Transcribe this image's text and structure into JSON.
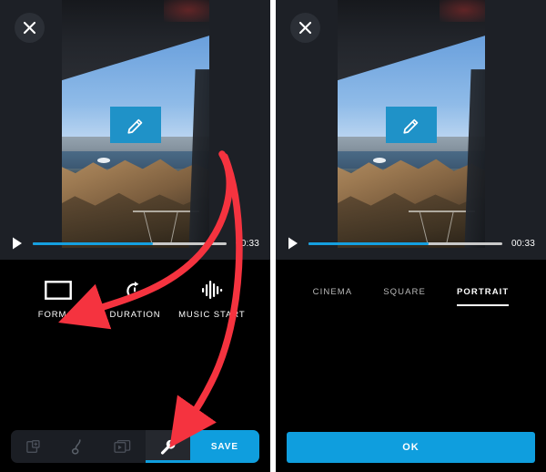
{
  "meta": {
    "app_type": "mobile-video-editor",
    "accent_blue": "#0f9ede",
    "annotation_red": "#f5333f",
    "panel_bg": "#1d2026",
    "sheet_bg": "#000000"
  },
  "left_panel": {
    "close_button_label": "✕",
    "close_icon_name": "close-icon",
    "preview": {
      "edit_badge_icon": "pencil-icon",
      "edit_badge_color": "#1f92c8"
    },
    "transport": {
      "play_icon": "play-icon",
      "progress_percent": 62,
      "time_label": "00:33"
    },
    "tools": [
      {
        "label": "FORMAT",
        "icon": "rectangle-format-icon"
      },
      {
        "label": "DURATION",
        "icon": "stopwatch-duration-icon"
      },
      {
        "label": "MUSIC START",
        "icon": "waveform-music-icon"
      }
    ],
    "tabbar": {
      "items": [
        {
          "icon": "add-clip-icon",
          "selected": false
        },
        {
          "icon": "music-note-icon",
          "selected": false
        },
        {
          "icon": "layers-clips-icon",
          "selected": false
        },
        {
          "icon": "wrench-tools-icon",
          "selected": true
        }
      ],
      "save_label": "SAVE"
    }
  },
  "right_panel": {
    "close_button_label": "✕",
    "close_icon_name": "close-icon",
    "preview": {
      "edit_badge_icon": "pencil-icon",
      "edit_badge_color": "#1f92c8"
    },
    "transport": {
      "play_icon": "play-icon",
      "progress_percent": 62,
      "time_label": "00:33"
    },
    "format_tabs": [
      {
        "label": "CINEMA",
        "active": false
      },
      {
        "label": "SQUARE",
        "active": false
      },
      {
        "label": "PORTRAIT",
        "active": true
      }
    ],
    "confirm_button_label": "OK"
  },
  "annotations": {
    "arrow_1_name": "red-arrow-to-format",
    "arrow_2_name": "red-arrow-to-wrench-tab",
    "color": "#f5333f"
  }
}
